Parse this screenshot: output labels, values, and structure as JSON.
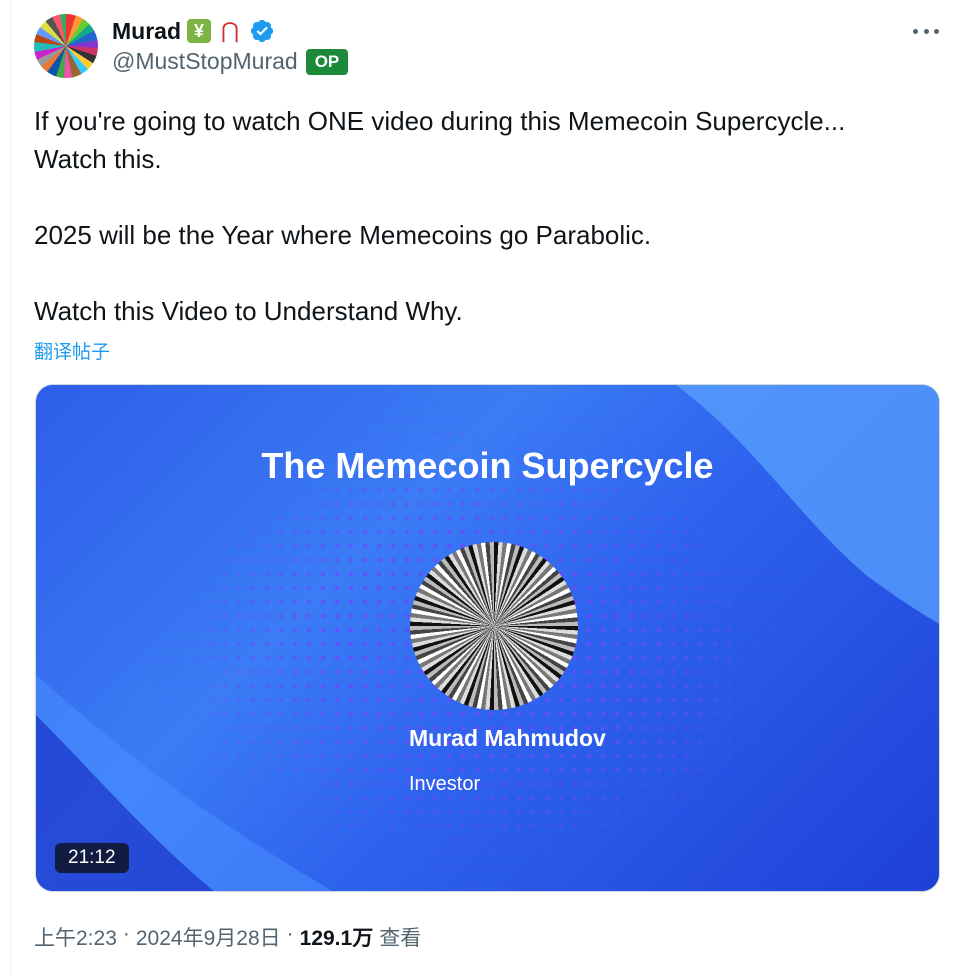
{
  "author": {
    "display_name": "Murad",
    "handle": "@MustStopMurad",
    "badge": "OP",
    "verified": true,
    "emoji": [
      "chart-yen-icon",
      "magnet-icon"
    ]
  },
  "tweet": {
    "paragraphs": [
      "If you're going to watch ONE video during this Memecoin Supercycle...",
      "Watch this.",
      "2025 will be the Year where Memecoins go Parabolic.",
      "Watch this Video to Understand Why."
    ],
    "translate_link": "翻译帖子"
  },
  "video": {
    "title": "The Memecoin Supercycle",
    "speaker_name": "Murad Mahmudov",
    "speaker_title": "Investor",
    "duration": "21:12"
  },
  "meta": {
    "time": "上午2:23",
    "date": "2024年9月28日",
    "views": "129.1万",
    "views_label": "查看"
  },
  "colors": {
    "accent": "#1d9bf0",
    "op_badge": "#1d8a3a",
    "secondary_text": "#536471"
  }
}
